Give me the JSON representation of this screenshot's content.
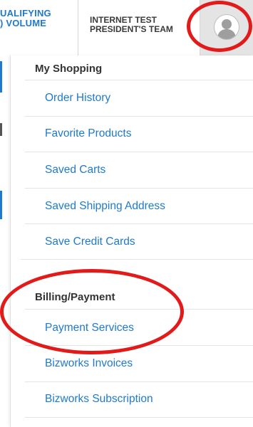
{
  "header": {
    "qualifying_text": "UALIFYING\n) VOLUME",
    "account_name": "INTERNET TEST\nPRESIDENT'S TEAM",
    "profile_icon": "user-avatar-icon"
  },
  "menu": {
    "sections": [
      {
        "title": "My Shopping",
        "items": [
          "Order History",
          "Favorite Products",
          "Saved Carts",
          "Saved Shipping Address",
          "Save Credit Cards"
        ]
      },
      {
        "title": "Billing/Payment",
        "items": [
          "Payment Services",
          "Bizworks Invoices",
          "Bizworks Subscription"
        ]
      }
    ]
  },
  "colors": {
    "link": "#1f7acb",
    "heading": "#333333",
    "annotation": "#e21a1a",
    "profile_tab_bg": "#e4e4e4"
  }
}
